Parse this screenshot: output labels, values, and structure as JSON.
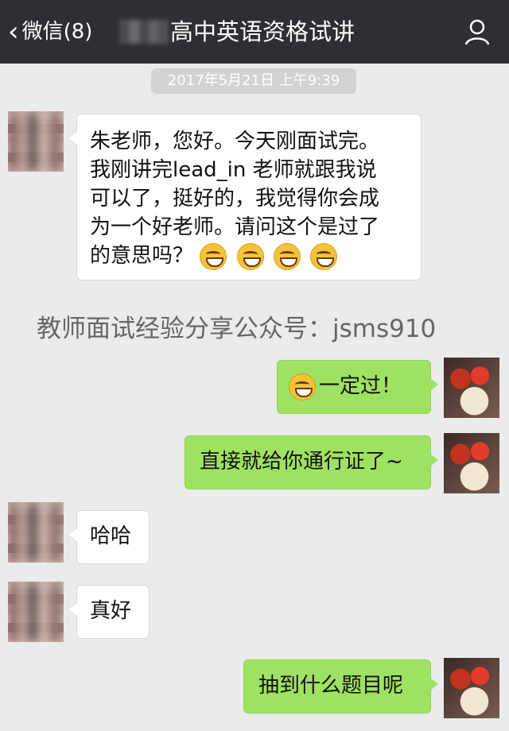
{
  "top_bar": {
    "back_label": "微信(8)",
    "title": "高中英语资格试讲"
  },
  "timestamp": "2017年5月21日 上午9:39",
  "messages": [
    {
      "side": "left",
      "lines": [
        "朱老师，您好。今天刚面试完。",
        "我刚讲完lead_in 老师就跟我说",
        "可以了，挺好的，我觉得你会成",
        "为一个好老师。请问这个是过了",
        "的意思吗？"
      ],
      "emojis": [
        "grin-emoji",
        "grin-emoji",
        "grin-emoji",
        "grin-emoji"
      ]
    },
    {
      "side": "right",
      "text": "一定过！",
      "leading_emoji": "grin-emoji"
    },
    {
      "side": "right",
      "text": "直接就给你通行证了~"
    },
    {
      "side": "left",
      "text": "哈哈"
    },
    {
      "side": "left",
      "text": "真好"
    },
    {
      "side": "right",
      "text": "抽到什么题目呢"
    }
  ],
  "watermark": "教师面试经验分享公众号：jsms910",
  "colors": {
    "top_bar_bg": "#2f2f33",
    "chat_bg": "#ebebeb",
    "bubble_right_bg": "#9fe262",
    "bubble_left_bg": "#ffffff"
  }
}
